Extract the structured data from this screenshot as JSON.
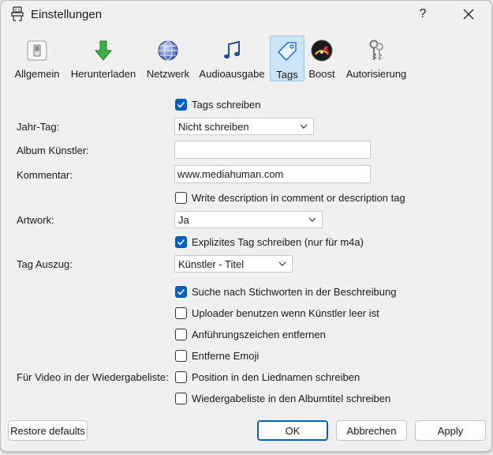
{
  "window": {
    "title": "Einstellungen",
    "help_label": "?",
    "close_label": "✕"
  },
  "toolbar": {
    "items": [
      {
        "label": "Allgemein",
        "icon": "switch-icon"
      },
      {
        "label": "Herunterladen",
        "icon": "download-arrow-icon"
      },
      {
        "label": "Netzwerk",
        "icon": "globe-icon"
      },
      {
        "label": "Audioausgabe",
        "icon": "music-note-icon"
      },
      {
        "label": "Tags",
        "icon": "tag-icon",
        "active": true
      },
      {
        "label": "Boost",
        "icon": "speedometer-icon"
      },
      {
        "label": "Autorisierung",
        "icon": "keys-icon"
      }
    ]
  },
  "form": {
    "write_tags": {
      "label": "Tags schreiben",
      "checked": true
    },
    "year_tag": {
      "label": "Jahr-Tag:",
      "value": "Nicht schreiben"
    },
    "album_artist": {
      "label": "Album Künstler:",
      "value": ""
    },
    "comment": {
      "label": "Kommentar:",
      "value": "www.mediahuman.com"
    },
    "write_description": {
      "label": "Write description in comment or description tag",
      "checked": false
    },
    "artwork": {
      "label": "Artwork:",
      "value": "Ja"
    },
    "explicit_tag": {
      "label": "Explizites Tag schreiben (nur für m4a)",
      "checked": true
    },
    "tag_extract": {
      "label": "Tag Auszug:",
      "value": "Künstler - Titel"
    },
    "search_keywords": {
      "label": "Suche nach Stichworten in der Beschreibung",
      "checked": true
    },
    "use_uploader": {
      "label": "Uploader benutzen wenn Künstler leer ist",
      "checked": false
    },
    "remove_quotes": {
      "label": "Anführungszeichen entfernen",
      "checked": false
    },
    "remove_emoji": {
      "label": "Entferne Emoji",
      "checked": false
    },
    "playlist_video_label": "Für Video in der Wiedergabeliste:",
    "position_in_name": {
      "label": "Position in den Liednamen schreiben",
      "checked": false
    },
    "playlist_in_album": {
      "label": "Wiedergabeliste in den Albumtitel schreiben",
      "checked": false
    }
  },
  "buttons": {
    "restore": "Restore defaults",
    "ok": "OK",
    "cancel": "Abbrechen",
    "apply": "Apply"
  },
  "colors": {
    "accent": "#005fb8",
    "active_tab_bg": "#cce4f7",
    "window_bg": "#f0f0f0"
  }
}
